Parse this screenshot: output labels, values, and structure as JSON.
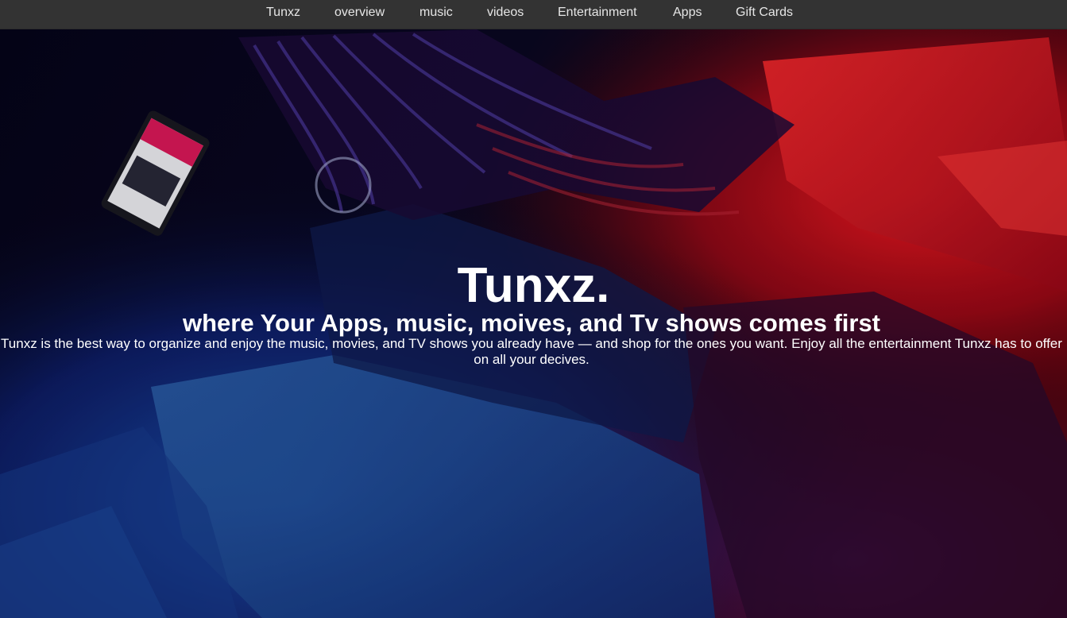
{
  "nav": {
    "items": [
      {
        "label": "Tunxz"
      },
      {
        "label": "overview"
      },
      {
        "label": "music"
      },
      {
        "label": "videos"
      },
      {
        "label": "Entertainment"
      },
      {
        "label": "Apps"
      },
      {
        "label": "Gift Cards"
      }
    ]
  },
  "hero": {
    "title": "Tunxz.",
    "subtitle": "where Your Apps, music, moives, and Tv shows comes first",
    "description": "Tunxz is the best way to organize and enjoy the music, movies, and TV shows you already have — and shop for the ones you want. Enjoy all the entertainment Tunxz has to offer on all your decives."
  },
  "colors": {
    "nav_background": "#333333",
    "nav_text": "#e6e6e6",
    "hero_text": "#ffffff",
    "hero_blue": "#1b3fa8",
    "hero_red": "#e01020"
  }
}
